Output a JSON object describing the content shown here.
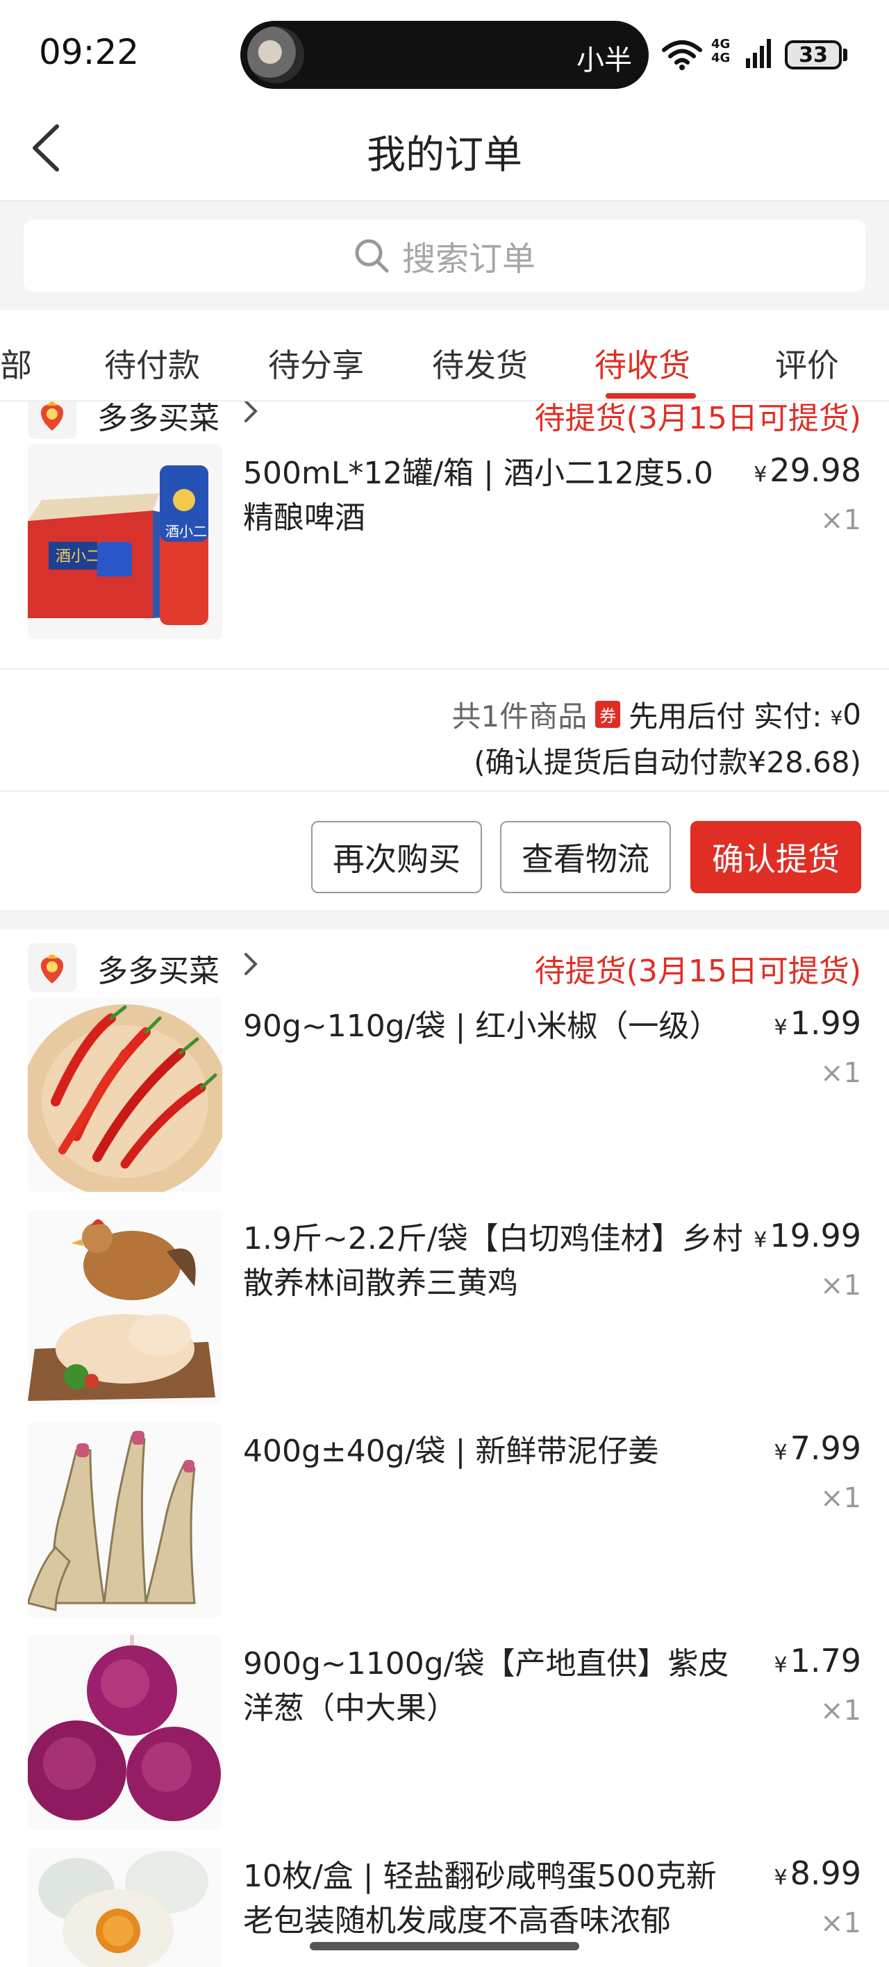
{
  "status_bar": {
    "time": "09:22",
    "island_label": "小半",
    "network": "4G\n4G",
    "battery": "33"
  },
  "header": {
    "title": "我的订单"
  },
  "search": {
    "placeholder": "搜索订单"
  },
  "tabs": [
    {
      "label": "部"
    },
    {
      "label": "待付款"
    },
    {
      "label": "待分享"
    },
    {
      "label": "待发货"
    },
    {
      "label": "待收货",
      "active": true
    },
    {
      "label": "评价"
    }
  ],
  "orders": [
    {
      "shop": "多多买菜",
      "status": "待提货(3月15日可提货)",
      "items": [
        {
          "title": "500mL*12罐/箱 | 酒小二12度5.0精酿啤酒",
          "currency": "¥",
          "price": "29.98",
          "qty": "×1",
          "image": "beer-box"
        }
      ],
      "summary": {
        "count": "共1件商品",
        "coupon": "券",
        "pay_mode": "先用后付",
        "paid_label": "实付:",
        "currency": "¥",
        "paid": "0",
        "note": "(确认提货后自动付款¥28.68)"
      },
      "buttons": {
        "rebuy": "再次购买",
        "logistics": "查看物流",
        "confirm": "确认提货"
      }
    },
    {
      "shop": "多多买菜",
      "status": "待提货(3月15日可提货)",
      "items": [
        {
          "title": "90g~110g/袋 | 红小米椒（一级）",
          "currency": "¥",
          "price": "1.99",
          "qty": "×1",
          "image": "chili"
        },
        {
          "title": "1.9斤~2.2斤/袋【白切鸡佳材】乡村散养林间散养三黄鸡",
          "currency": "¥",
          "price": "19.99",
          "qty": "×1",
          "image": "chicken"
        },
        {
          "title": "400g±40g/袋 | 新鲜带泥仔姜",
          "currency": "¥",
          "price": "7.99",
          "qty": "×1",
          "image": "ginger"
        },
        {
          "title": "900g~1100g/袋【产地直供】紫皮洋葱（中大果）",
          "currency": "¥",
          "price": "1.79",
          "qty": "×1",
          "image": "onion"
        },
        {
          "title": "10枚/盒 | 轻盐翻砂咸鸭蛋500克新老包装随机发咸度不高香味浓郁",
          "currency": "¥",
          "price": "8.99",
          "qty": "×1",
          "image": "salted-egg"
        }
      ]
    }
  ],
  "colors": {
    "accent": "#e02e24",
    "background": "#f4f4f4",
    "text": "#222222",
    "muted": "#999999"
  }
}
